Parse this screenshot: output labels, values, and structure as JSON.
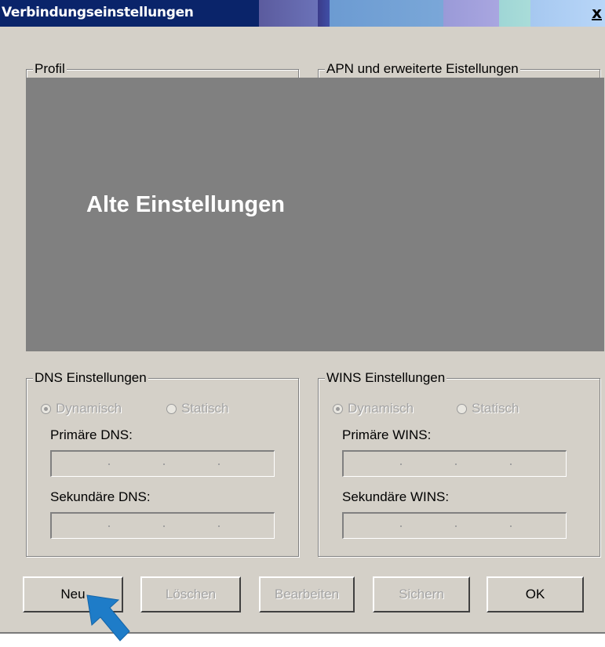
{
  "window": {
    "title": "Verbindungseinstellungen",
    "close_label": "x"
  },
  "groups": {
    "profil": "Profil",
    "apn": "APN und erweiterte Eistellungen",
    "dns": "DNS Einstellungen",
    "wins": "WINS Einstellungen"
  },
  "overlay": {
    "text": "Alte Einstellungen",
    "color": "#808080"
  },
  "dns": {
    "radio_dynamic": "Dynamisch",
    "radio_static": "Statisch",
    "selected": "Dynamisch",
    "primary_label": "Primäre DNS:",
    "secondary_label": "Sekundäre DNS:",
    "primary_value": "",
    "secondary_value": ""
  },
  "wins": {
    "radio_dynamic": "Dynamisch",
    "radio_static": "Statisch",
    "selected": "Dynamisch",
    "primary_label": "Primäre WINS:",
    "secondary_label": "Sekundäre WINS:",
    "primary_value": "",
    "secondary_value": ""
  },
  "buttons": {
    "neu": "Neu",
    "loeschen": "Löschen",
    "bearbeiten": "Bearbeiten",
    "sichern": "Sichern",
    "ok": "OK"
  },
  "annotation": {
    "arrow_icon": "pointer-arrow-icon",
    "arrow_color": "#1e7cc8"
  }
}
